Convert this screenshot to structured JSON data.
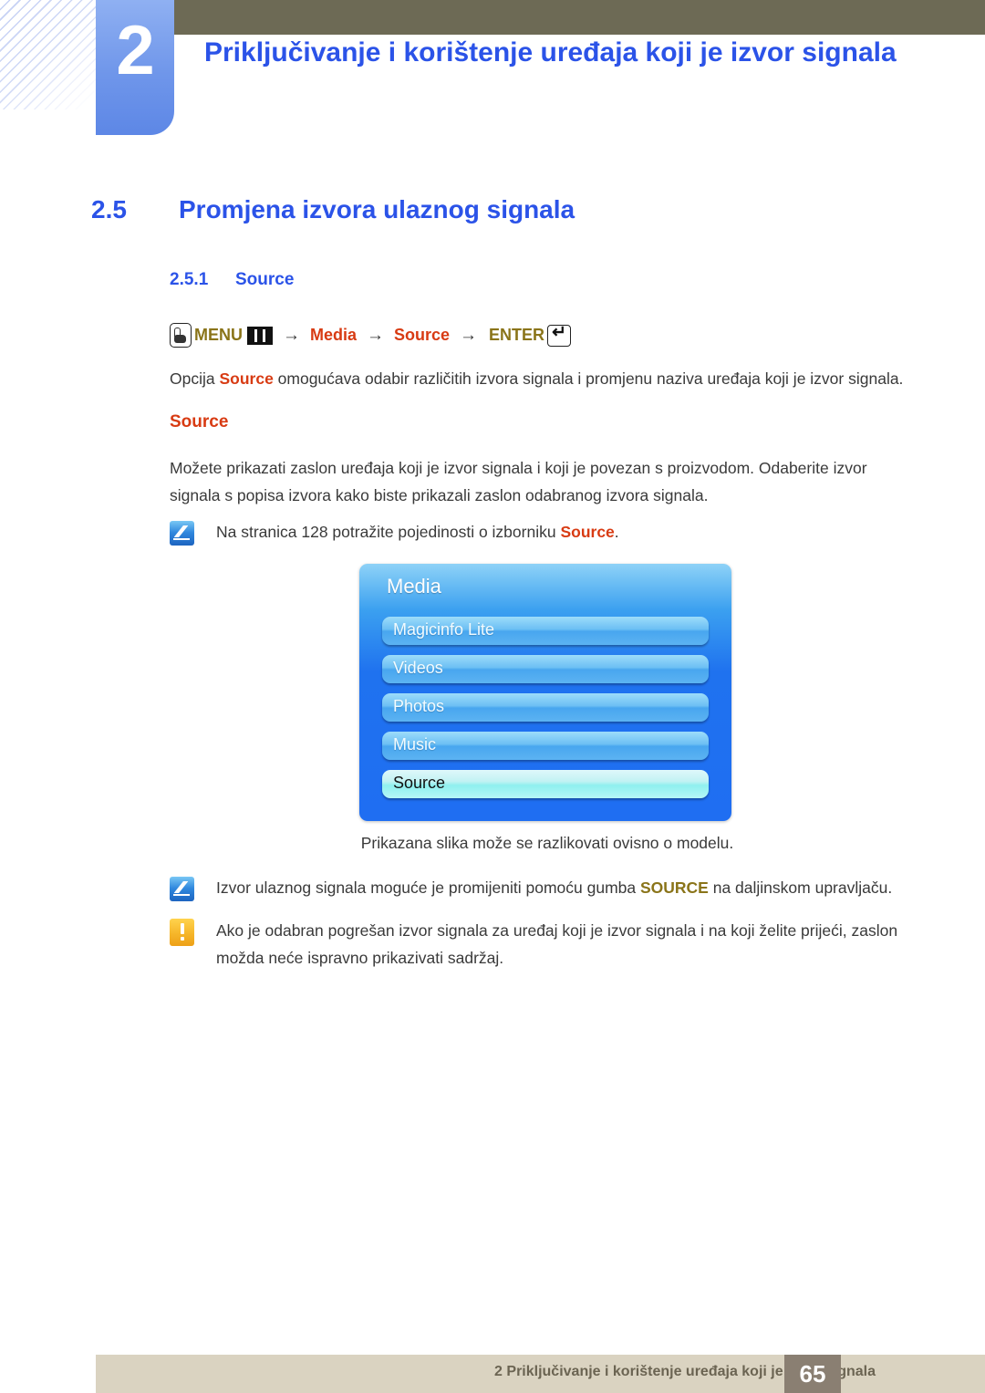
{
  "chapter": {
    "number": "2",
    "title": "Priključivanje i korištenje uređaja koji je izvor signala"
  },
  "section": {
    "number": "2.5",
    "title": "Promjena izvora ulaznog signala",
    "sub_number": "2.5.1",
    "sub_title": "Source"
  },
  "menu_path": {
    "hand_icon": "hand-press-icon",
    "menu_label": "MENU",
    "bars_icon": "menu-bars-icon",
    "arrow": "→",
    "item1": "Media",
    "item2": "Source",
    "enter_label": "ENTER",
    "enter_icon": "enter-key-icon"
  },
  "body": {
    "p1_before": "Opcija ",
    "p1_bold": "Source",
    "p1_after": " omogućava odabir različitih izvora signala i promjenu naziva uređaja koji je izvor signala.",
    "subtitle": "Source",
    "p2": "Možete prikazati zaslon uređaja koji je izvor signala i koji je povezan s proizvodom. Odaberite izvor signala s popisa izvora kako biste prikazali zaslon odabranog izvora signala."
  },
  "notes": {
    "note1_before": "Na stranica 128 potražite pojedinosti o izborniku ",
    "note1_bold": "Source",
    "note1_after": ".",
    "note2_before": "Izvor ulaznog signala moguće je promijeniti pomoću gumba ",
    "note2_bold": "SOURCE",
    "note2_after": " na daljinskom upravljaču.",
    "note3": "Ako je odabran pogrešan izvor signala za uređaj koji je izvor signala i na koji želite prijeći, zaslon možda neće ispravno prikazivati sadržaj."
  },
  "osd": {
    "title": "Media",
    "items": [
      {
        "label": "Magicinfo Lite",
        "selected": false
      },
      {
        "label": "Videos",
        "selected": false
      },
      {
        "label": "Photos",
        "selected": false
      },
      {
        "label": "Music",
        "selected": false
      },
      {
        "label": "Source",
        "selected": true
      }
    ]
  },
  "caption": "Prikazana slika može se razlikovati ovisno o modelu.",
  "footer": {
    "text": "2 Priključivanje i korištenje uređaja koji je izvor signala",
    "page": "65"
  },
  "colors": {
    "heading_blue": "#2b53e8",
    "accent_red": "#d83b13",
    "accent_olive": "#8a7419",
    "olive_bar": "#6d6a55",
    "footer_bar": "#dad3c1",
    "page_badge": "#8a7f72"
  }
}
